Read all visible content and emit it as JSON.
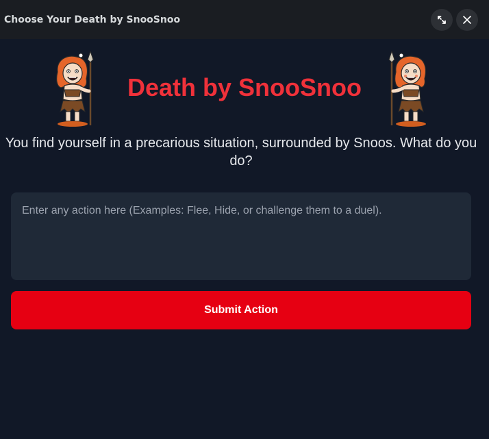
{
  "window": {
    "title": "Choose Your Death by SnooSnoo",
    "expand_icon": "expand-icon",
    "close_icon": "close-icon"
  },
  "hero": {
    "headline": "Death by SnooSnoo",
    "left_image": "cavewoman-with-spear-illustration",
    "right_image": "cavewoman-with-spear-illustration"
  },
  "intro": {
    "text": "You find yourself in a precarious situation, surrounded by Snoos. What do you do?"
  },
  "action": {
    "value": "",
    "placeholder": "Enter any action here (Examples: Flee, Hide, or challenge them to a duel).",
    "submit_label": "Submit Action"
  },
  "colors": {
    "background": "#111827",
    "titlebar": "#1a1d22",
    "headline": "#f0313a",
    "input_bg": "#1f2937",
    "button": "#e60012"
  }
}
